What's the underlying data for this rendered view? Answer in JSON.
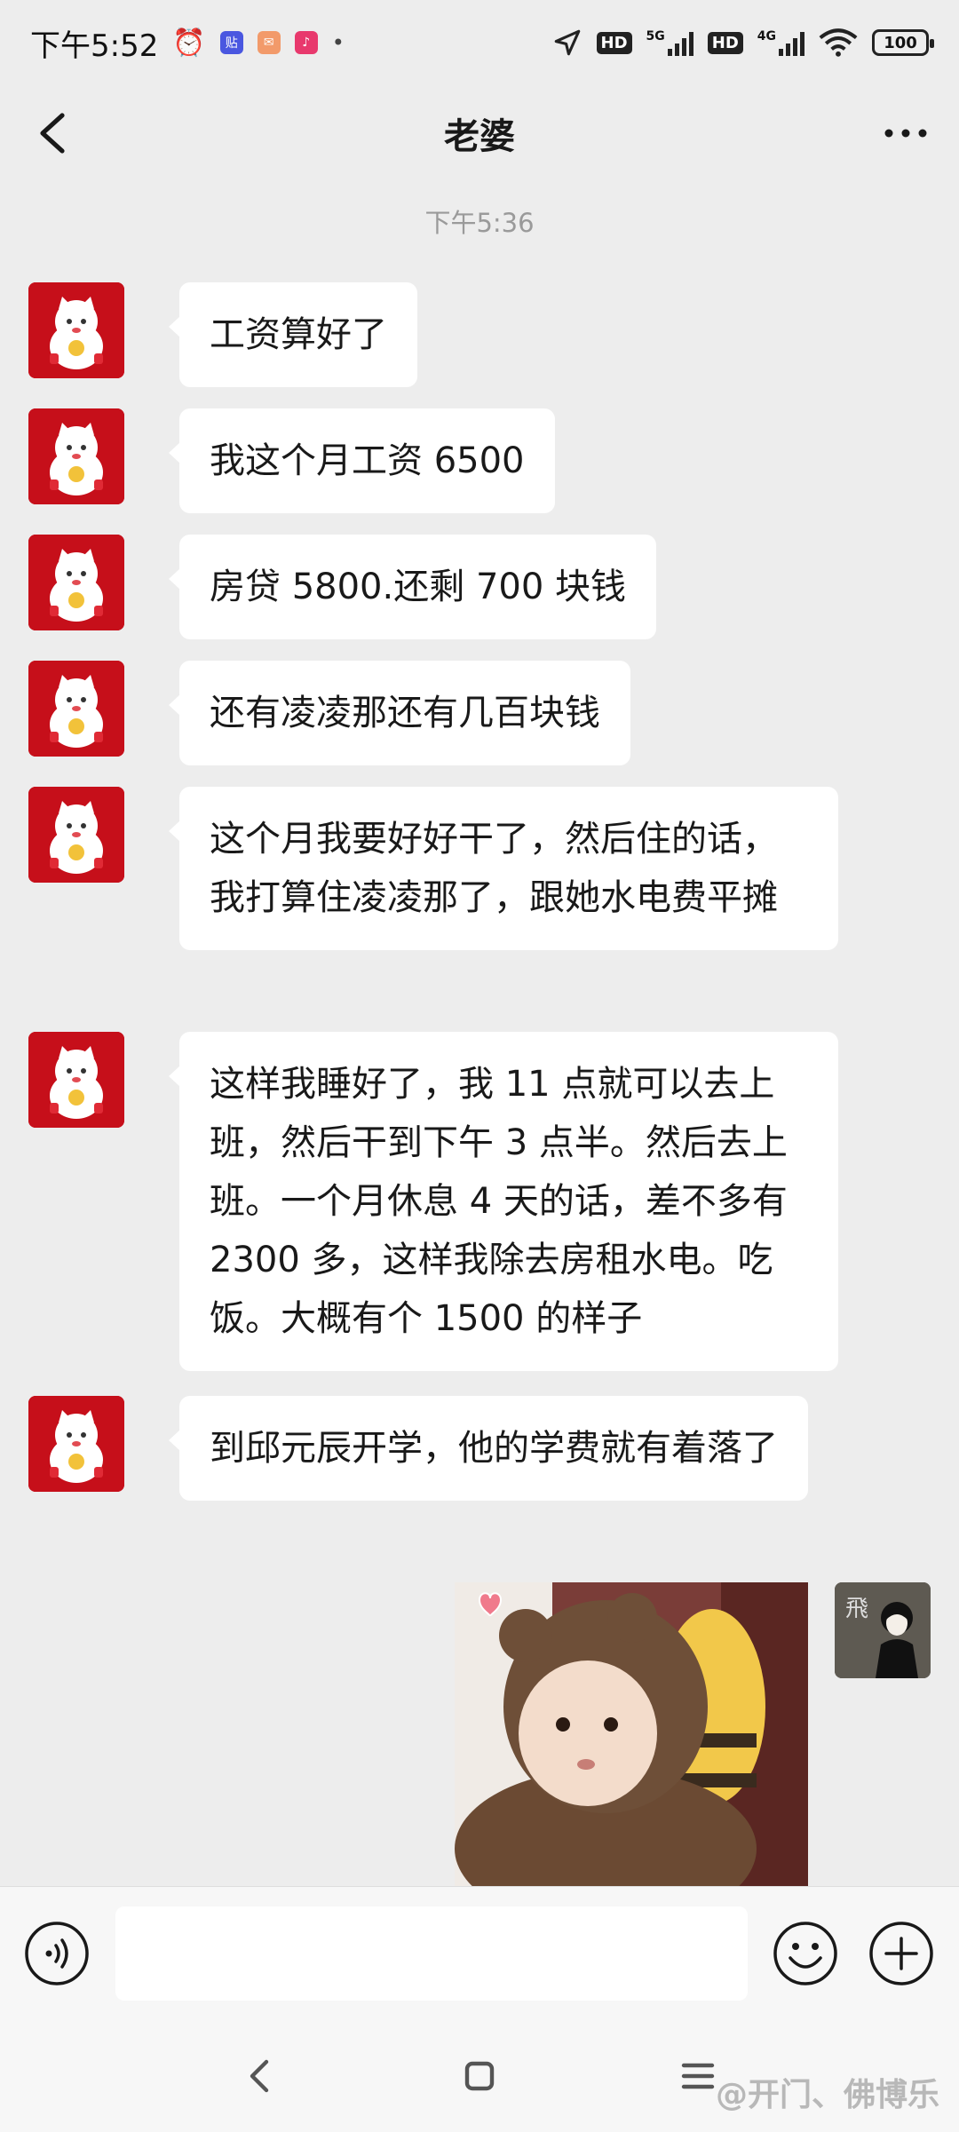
{
  "status_bar": {
    "time": "下午5:52",
    "app_icons": [
      "alarm-icon",
      "tieba-app-icon",
      "mail-app-icon",
      "music-app-icon"
    ],
    "network_5g": "5G",
    "network_4g": "4G",
    "hd1": "HD",
    "hd2": "HD",
    "battery": "100"
  },
  "header": {
    "title": "老婆",
    "back_icon": "chevron-left-icon",
    "more_icon": "more-dots-icon"
  },
  "chat": {
    "timestamp": "下午5:36",
    "messages": [
      {
        "sender": "other",
        "text": "工资算好了"
      },
      {
        "sender": "other",
        "text": "我这个月工资 6500"
      },
      {
        "sender": "other",
        "text": "房贷 5800.还剩 700 块钱"
      },
      {
        "sender": "other",
        "text": "还有凌凌那还有几百块钱"
      },
      {
        "sender": "other",
        "text": "这个月我要好好干了，然后住的话，我打算住凌凌那了，跟她水电费平摊"
      },
      {
        "sender": "other",
        "text": "这样我睡好了，我 11 点就可以去上班，然后干到下午 3 点半。然后去上班。一个月休息 4 天的话，差不多有 2300 多，这样我除去房租水电。吃饭。大概有个 1500 的样子"
      },
      {
        "sender": "other",
        "text": "到邱元辰开学，他的学费就有着落了"
      }
    ],
    "self_avatar_char": "飛"
  },
  "input_bar": {
    "placeholder": "",
    "voice_icon": "voice-icon",
    "emoji_icon": "emoji-icon",
    "plus_icon": "plus-icon"
  },
  "watermark": "@开门、佛博乐",
  "colors": {
    "background": "#ededed",
    "bubble": "#ffffff",
    "avatar_red": "#c60f1a"
  }
}
